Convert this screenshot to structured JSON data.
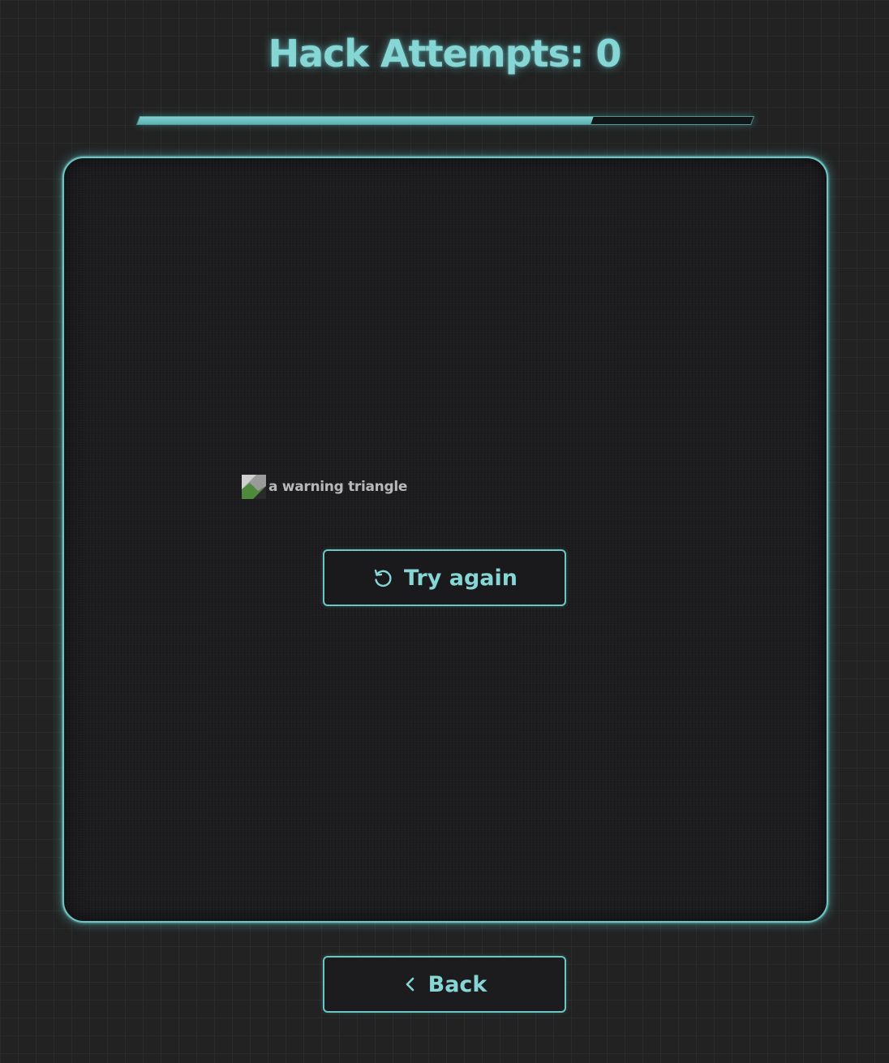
{
  "header": {
    "title": "Hack Attempts: 0"
  },
  "progress": {
    "fraction": 0.74
  },
  "panel": {
    "image_alt": "a warning triangle",
    "retry_label": "Try again",
    "retry_icon": "retry-icon"
  },
  "footer": {
    "back_label": "Back",
    "back_icon": "chevron-left-icon"
  },
  "colors": {
    "accent": "#6cc6c6",
    "title": "#86d6d6",
    "background": "#222222",
    "panel": "#1d1c1f"
  }
}
